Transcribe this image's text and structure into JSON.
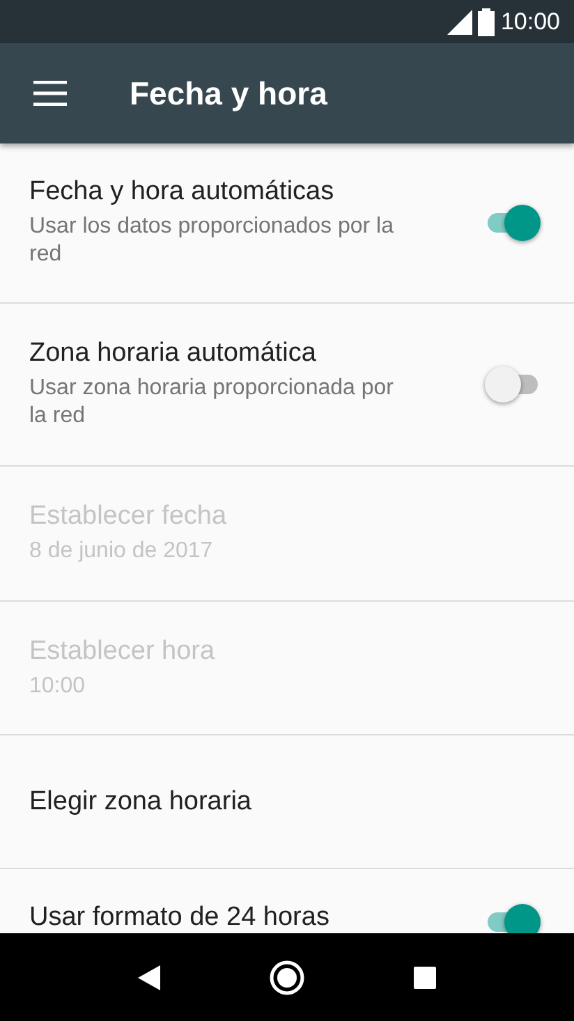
{
  "status_bar": {
    "time": "10:00"
  },
  "toolbar": {
    "title": "Fecha y hora"
  },
  "settings": [
    {
      "kind": "switch",
      "title": "Fecha y hora automáticas",
      "summary": "Usar los datos proporcionados por la red",
      "on": true,
      "disabled": false
    },
    {
      "kind": "switch",
      "title": "Zona horaria automática",
      "summary": "Usar zona horaria proporcionada por la red",
      "on": false,
      "disabled": false
    },
    {
      "kind": "plain",
      "title": "Establecer fecha",
      "summary": "8 de junio de 2017",
      "disabled": true
    },
    {
      "kind": "plain",
      "title": "Establecer hora",
      "summary": "10:00",
      "disabled": true
    },
    {
      "kind": "plain",
      "title": "Elegir zona horaria",
      "disabled": false
    },
    {
      "kind": "switch",
      "title": "Usar formato de 24 horas",
      "on": true,
      "disabled": false
    }
  ]
}
